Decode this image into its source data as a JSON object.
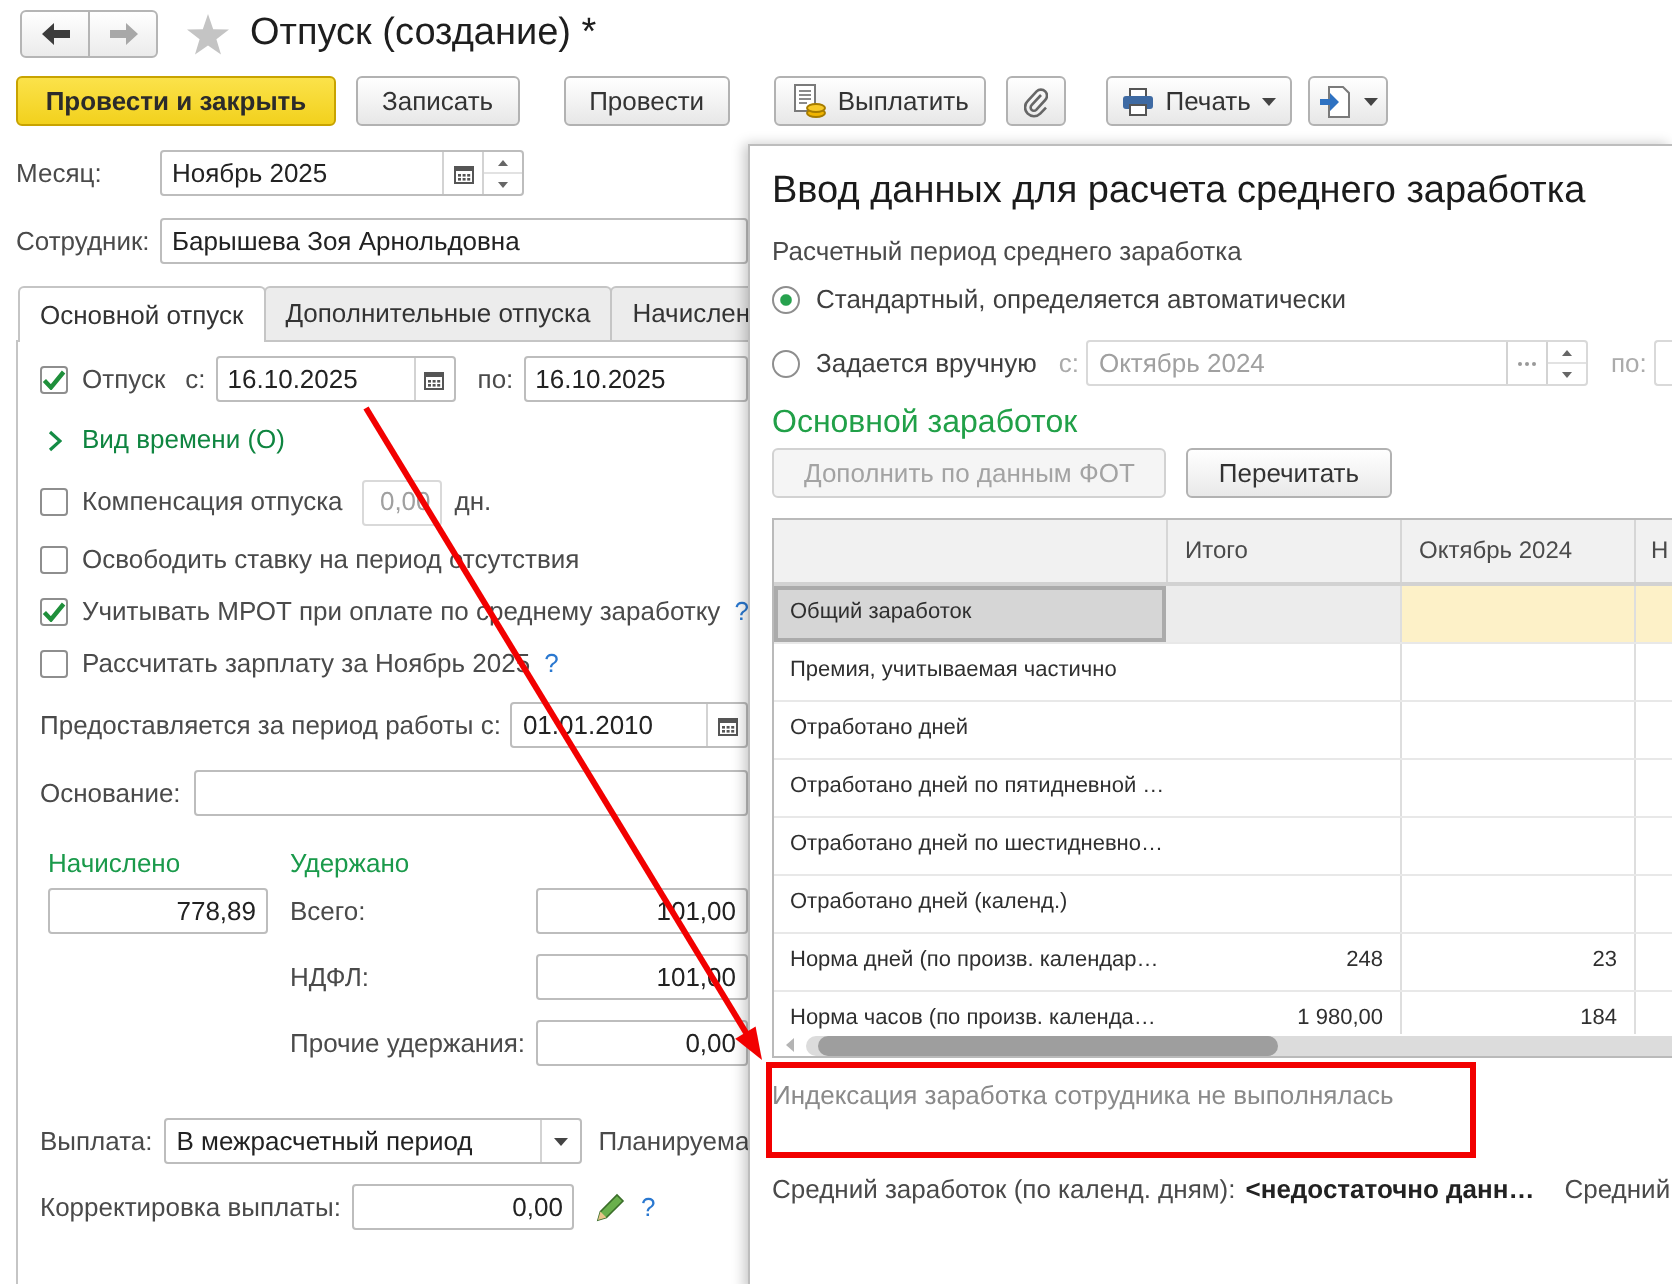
{
  "window": {
    "title": "Отпуск (создание) *"
  },
  "navigation": [
    {
      "kind": "back",
      "disabled": false
    },
    {
      "kind": "forward",
      "disabled": true
    }
  ],
  "toolbar": [
    {
      "kind": "primary",
      "label": "Провести и закрыть"
    },
    {
      "kind": "plain",
      "label": "Записать"
    },
    {
      "kind": "plain",
      "label": "Провести"
    },
    {
      "kind": "pay",
      "label": "Выплатить"
    },
    {
      "kind": "attach"
    },
    {
      "kind": "print",
      "label": "Печать",
      "dropdown": true
    },
    {
      "kind": "exchange",
      "dropdown": true
    }
  ],
  "month": {
    "label": "Месяц:",
    "value": "Ноябрь 2025"
  },
  "employee": {
    "label": "Сотрудник:",
    "value": "Барышева Зоя Арнольдовна"
  },
  "tabs": [
    {
      "label": "Основной отпуск",
      "selected": true
    },
    {
      "label": "Дополнительные отпуска",
      "selected": false
    },
    {
      "label": "Начислен",
      "selected": false
    }
  ],
  "vacation": {
    "label": "Отпуск",
    "checked": true,
    "from_label": "с:",
    "from": "16.10.2025",
    "to_label": "по:",
    "to": "16.10.2025"
  },
  "time_kind": {
    "label": "Вид времени (О)",
    "expanded": false
  },
  "options": [
    {
      "label": "Компенсация отпуска",
      "checked": false,
      "field": {
        "value": "0,00",
        "disabled": true,
        "unit": "дн."
      }
    },
    {
      "label": "Освободить ставку на период отсутствия",
      "checked": false
    },
    {
      "label": "Учитывать МРОТ при оплате по среднему заработку",
      "checked": true,
      "help": "?"
    },
    {
      "label": "Рассчитать зарплату за Ноябрь 2025",
      "checked": false,
      "help": "?"
    }
  ],
  "work_period": {
    "label": "Предоставляется за период работы с:",
    "value": "01.01.2010"
  },
  "basis": {
    "label": "Основание:"
  },
  "accrued": {
    "title": "Начислено",
    "value": "778,89"
  },
  "withheld": {
    "title": "Удержано",
    "rows": [
      {
        "label": "Всего:",
        "value": "101,00"
      },
      {
        "label": "НДФЛ:",
        "value": "101,00"
      },
      {
        "label": "Прочие удержания:",
        "value": "0,00"
      }
    ]
  },
  "payment": {
    "label": "Выплата:",
    "value": "В межрасчетный период",
    "trailing_label": "Планируема"
  },
  "payment_correction": {
    "label": "Корректировка выплаты:",
    "value": "0,00",
    "help": "?"
  },
  "dialog": {
    "title": "Ввод данных для расчета среднего заработка",
    "period_title": "Расчетный период среднего заработка",
    "period_options": [
      {
        "label": "Стандартный, определяется автоматически",
        "selected": true
      },
      {
        "label": "Задается вручную",
        "selected": false,
        "range": {
          "from_label": "с:",
          "from": "Октябрь 2024",
          "to_label": "по:",
          "disabled": true
        }
      }
    ],
    "section_title": "Основной заработок",
    "buttons": [
      {
        "label": "Дополнить по данным ФОТ",
        "disabled": true
      },
      {
        "label": "Перечитать",
        "disabled": false
      }
    ],
    "table": {
      "columns": [
        "Итого",
        "Октябрь 2024",
        "Н"
      ],
      "rows": [
        {
          "label": "Общий заработок",
          "selected": true
        },
        {
          "label": "Премия, учитываемая частично",
          "selected": false
        },
        {
          "label": "Отработано дней",
          "selected": false
        },
        {
          "label": "Отработано дней по пятидневной …",
          "selected": false
        },
        {
          "label": "Отработано дней по шестидневно…",
          "selected": false
        },
        {
          "label": "Отработано дней (календ.)",
          "selected": false
        },
        {
          "label": "Норма дней (по произв. календар…",
          "selected": false,
          "values": [
            "248",
            "23"
          ]
        },
        {
          "label": "Норма часов (по произв. календа…",
          "selected": false,
          "values": [
            "1 980,00",
            "184"
          ]
        }
      ]
    },
    "indexation_note": {
      "text": "Индексация заработка сотрудника не выполнялась",
      "highlighted": true
    },
    "average": {
      "label": "Средний заработок (по календ. дням):",
      "value": "<недостаточно данн…",
      "trailing_label": "Средний"
    }
  }
}
